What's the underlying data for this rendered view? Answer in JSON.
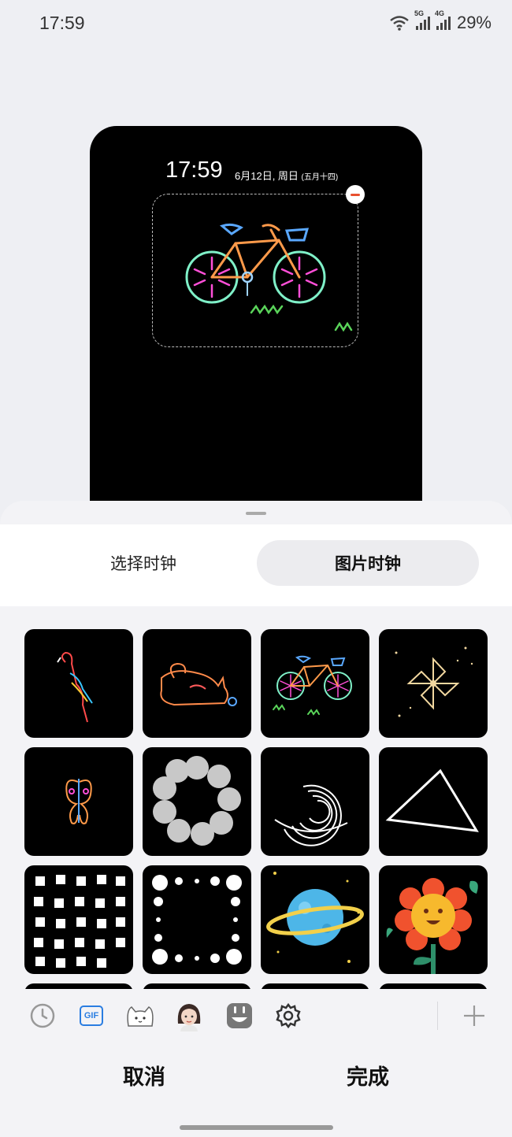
{
  "status_bar": {
    "time": "17:59",
    "wifi_icon": "wifi-icon",
    "sim1_label": "5G",
    "sim2_label": "4G",
    "battery": "29%"
  },
  "preview": {
    "clock_time": "17:59",
    "date": "6月12日, 周日",
    "lunar_date": "(五月十四)",
    "widget_image": "neon-bicycle"
  },
  "tabs": [
    {
      "label": "选择时钟",
      "selected": false
    },
    {
      "label": "图片时钟",
      "selected": true
    }
  ],
  "grid_items": [
    "neon-parrot",
    "neon-cat",
    "neon-bicycle",
    "pinwheel",
    "neon-butterfly",
    "circle-dots",
    "spiral-lines",
    "triangle",
    "cube-pattern",
    "dot-square",
    "planet",
    "sunflower"
  ],
  "toolbar": {
    "items": [
      "clock-icon",
      "gif-icon",
      "cat-sticker-icon",
      "girl-avatar-icon",
      "face-sticker-icon",
      "settings-icon"
    ],
    "gif_label": "GIF",
    "add_icon": "plus-icon"
  },
  "actions": {
    "cancel": "取消",
    "done": "完成"
  },
  "colors": {
    "accent_red": "#e8502f",
    "gif_blue": "#2a7de1"
  }
}
